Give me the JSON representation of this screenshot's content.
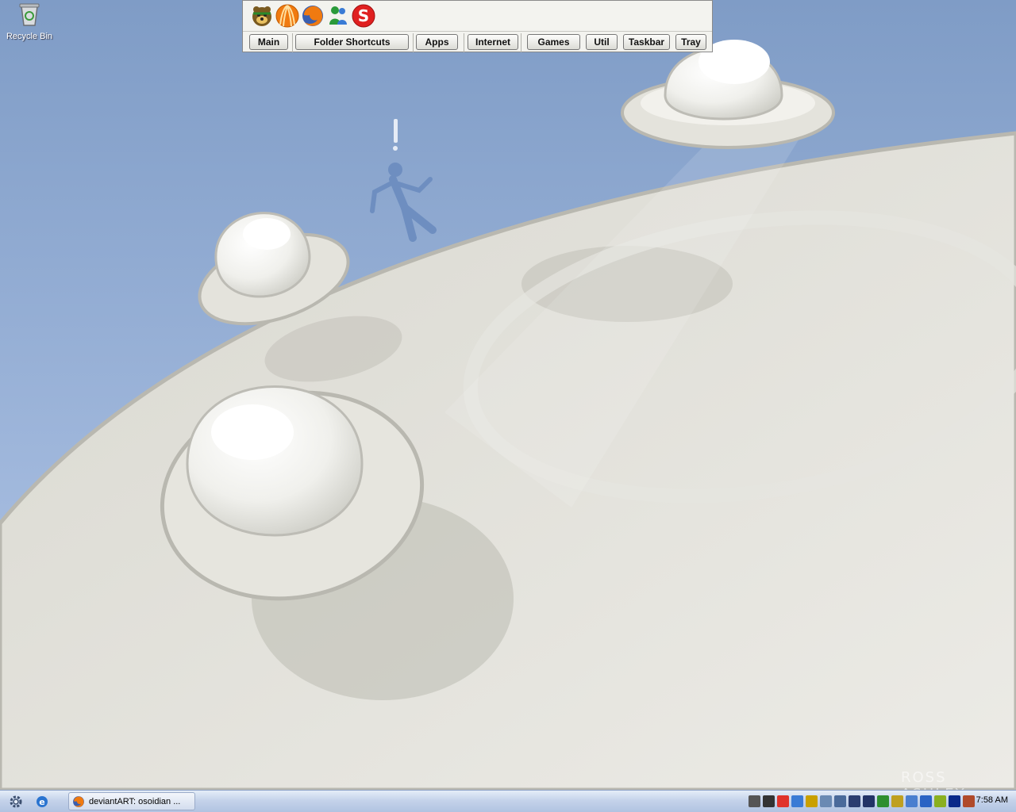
{
  "desktop": {
    "icons": [
      {
        "label": "Recycle Bin",
        "icon": "recycle-bin-icon"
      }
    ],
    "signature": "ROSS ASHLEY"
  },
  "launcher": {
    "quick_icons": [
      "bear-mascot-icon",
      "orange-stripes-icon",
      "firefox-icon",
      "messenger-icon",
      "skype-icon"
    ],
    "tabs": [
      "Main",
      "Folder Shortcuts",
      "Apps",
      "Internet",
      "Games",
      "Util",
      "Taskbar",
      "Tray"
    ]
  },
  "taskbar": {
    "start_icon": "gear-icon",
    "quicklaunch_icon": "internet-explorer-icon",
    "task": {
      "label": "deviantART: osoidian ...",
      "icon": "firefox-icon"
    },
    "clock": "7:58 AM",
    "tray_colors": [
      "#555555",
      "#333333",
      "#e0332b",
      "#3a7bd5",
      "#c9a000",
      "#6a8ab3",
      "#4a6a9a",
      "#2c3e70",
      "#223366",
      "#2f8f2f",
      "#bfa020",
      "#4a7fcf",
      "#2a63c4",
      "#8ab020",
      "#0a2a8a",
      "#b04a2a"
    ]
  }
}
